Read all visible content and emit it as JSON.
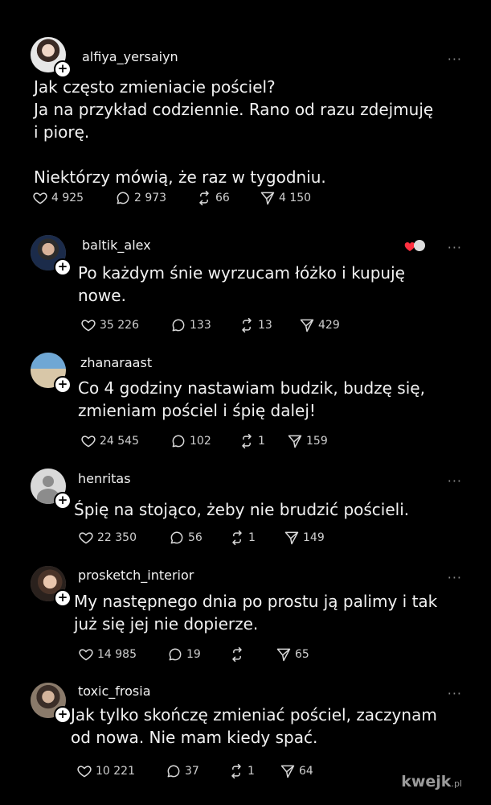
{
  "posts": [
    {
      "username": "alfiya_yersaiyn",
      "text": "Jak często zmieniacie pościel?\nJa na przykład codziennie. Rano od razu zdejmuję\ni piorę.\n\nNiektórzy mówią, że raz w tygodniu.",
      "likes": "4 925",
      "comments": "2 973",
      "reposts": "66",
      "shares": "4 150"
    },
    {
      "username": "baltik_alex",
      "text": "Po każdym śnie wyrzucam łóżko i kupuję\nnowe.",
      "likes": "35 226",
      "comments": "133",
      "reposts": "13",
      "shares": "429"
    },
    {
      "username": "zhanaraast",
      "text": "Co 4 godziny nastawiam budzik, budzę się,\nzmieniam pościel i śpię dalej!",
      "likes": "24 545",
      "comments": "102",
      "reposts": "1",
      "shares": "159"
    },
    {
      "username": "henritas",
      "text": "Śpię na stojąco, żeby nie brudzić pościeli.",
      "likes": "22 350",
      "comments": "56",
      "reposts": "1",
      "shares": "149"
    },
    {
      "username": "prosketch_interior",
      "text": "My następnego dnia po prostu ją palimy i tak\njuż się jej nie dopierze.",
      "likes": "14 985",
      "comments": "19",
      "reposts": "",
      "shares": "65"
    },
    {
      "username": "toxic_frosia",
      "text": "Jak tylko skończę zmieniać pościel, zaczynam\nod nowa. Nie mam kiedy spać.",
      "likes": "10 221",
      "comments": "37",
      "reposts": "1",
      "shares": "64"
    }
  ],
  "more_label": "···",
  "plus_label": "+",
  "watermark": {
    "main": "kwejk",
    "suffix": ".pl"
  },
  "icons": {
    "like": "heart-outline-icon",
    "comment": "speech-bubble-icon",
    "repost": "repost-arrows-icon",
    "share": "send-icon"
  }
}
